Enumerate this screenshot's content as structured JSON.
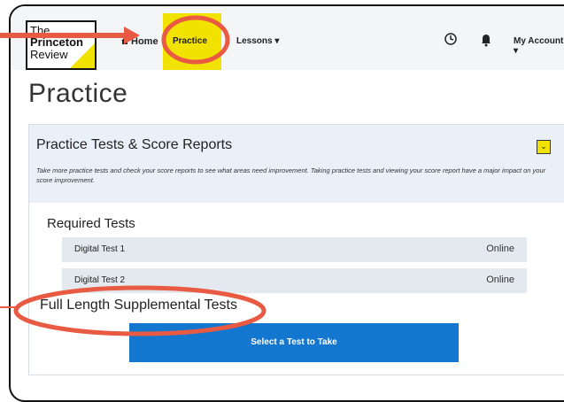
{
  "header": {
    "logo": {
      "line1": "The",
      "line2": "Princeton",
      "line3": "Review"
    },
    "nav": {
      "home": "Home",
      "practice": "Practice",
      "lessons": "Lessons ▾",
      "account": "My Account ▾"
    },
    "icons": {
      "home": "home-icon",
      "clock": "clock-icon",
      "bell": "bell-icon",
      "chevron": "chevron-down-icon"
    }
  },
  "page": {
    "title": "Practice",
    "card": {
      "title": "Practice Tests & Score Reports",
      "description": "Take more practice tests and check your score reports to see what areas need improvement. Taking practice tests and viewing your score report have a major impact on your score improvement.",
      "toggle": "⌄"
    },
    "required": {
      "title": "Required Tests",
      "rows": [
        {
          "name": "Digital Test 1",
          "status": "Online"
        },
        {
          "name": "Digital Test 2",
          "status": "Online"
        }
      ]
    },
    "supplemental": {
      "title": "Full Length Supplemental Tests",
      "button": "Select a Test to Take"
    }
  },
  "colors": {
    "accent_yellow": "#f2e200",
    "accent_blue": "#1477cf",
    "annotation_red": "#e85a42"
  }
}
